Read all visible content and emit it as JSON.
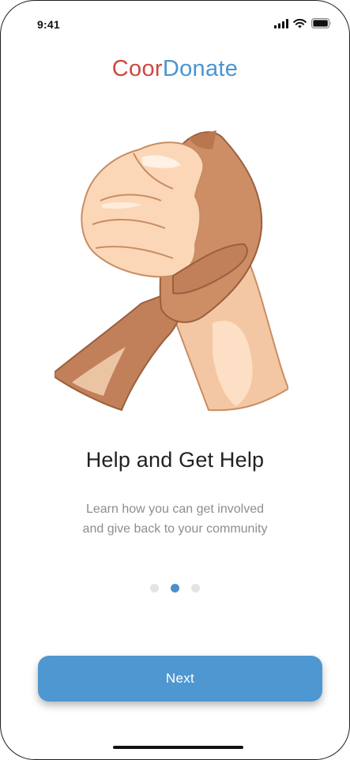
{
  "status_bar": {
    "time": "9:41",
    "icons": [
      "cellular-signal-icon",
      "wifi-icon",
      "battery-icon"
    ]
  },
  "logo": {
    "part_a": "Coor",
    "part_b": "Donate",
    "color_a": "#d0473e",
    "color_b": "#4a95d1"
  },
  "hero": {
    "illustration": "clasped-hands-illustration"
  },
  "onboarding": {
    "title": "Help and Get Help",
    "subtitle_line1": "Learn how you can get involved",
    "subtitle_line2": "and give back to your community"
  },
  "pager": {
    "total": 3,
    "active_index": 1,
    "active_color": "#4a90cf",
    "inactive_color": "#e4e4e6"
  },
  "actions": {
    "next_label": "Next",
    "next_color": "#4e97d1"
  }
}
